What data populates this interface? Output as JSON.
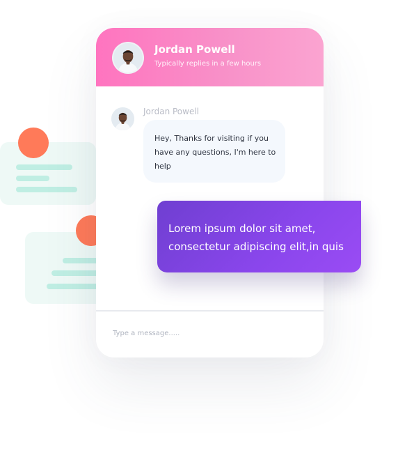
{
  "colors": {
    "header_gradient_start": "#ff74bf",
    "header_gradient_end": "#fba4d1",
    "user_bubble_start": "#6f3fd1",
    "user_bubble_end": "#9a4cf4",
    "accent_dot": "#ff7a59",
    "deco_card": "#eef9f6",
    "deco_line": "#bfeee3"
  },
  "chat": {
    "header": {
      "name": "Jordan Powell",
      "status": "Typically replies in a few hours",
      "avatar_icon": "person-avatar-icon"
    },
    "messages": [
      {
        "sender": "Jordan Powell",
        "text": "Hey, Thanks for visiting if you have any questions, I'm here to help"
      }
    ],
    "user_message": "Lorem ipsum dolor sit amet, consectetur adipiscing elit,in quis",
    "composer": {
      "placeholder": "Type a message....."
    }
  }
}
